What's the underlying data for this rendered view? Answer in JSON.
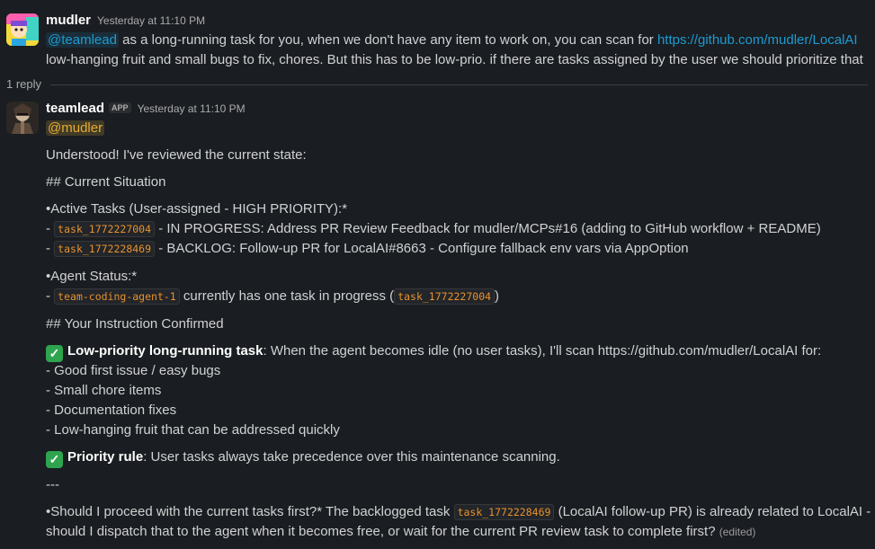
{
  "msg1": {
    "author": "mudler",
    "time": "Yesterday at 11:10 PM",
    "mention": "@teamlead",
    "text_a": " as a long-running task for you, when we don't have any item to work on, you can scan for ",
    "link": "https://github.com/mudler/LocalAI",
    "text_b": "low-hanging fruit and small bugs to fix, chores. But this has to be low-prio. if there are tasks assigned by the user we should prioritize that"
  },
  "replies": "1 reply",
  "msg2": {
    "author": "teamlead",
    "badge": "APP",
    "time": "Yesterday at 11:10 PM",
    "mention": "@mudler",
    "l1": "Understood! I've reviewed the current state:",
    "h1": "## Current Situation",
    "active": "•Active Tasks (User-assigned - HIGH PRIORITY):*",
    "dash": "- ",
    "task1_code": "task_1772227004",
    "task1_text": " - IN PROGRESS: Address PR Review Feedback for mudler/MCPs#16 (adding to GitHub workflow + README)",
    "task2_code": "task_1772228469",
    "task2_text": " - BACKLOG: Follow-up PR for LocalAI#8663 - Configure fallback env vars via AppOption",
    "agent": "•Agent Status:*",
    "agent_code": "team-coding-agent-1",
    "agent_text_a": " currently has one task in progress (",
    "agent_task_code": "task_1772227004",
    "agent_text_b": ")",
    "h2": "## Your Instruction Confirmed",
    "check_glyph": "✓",
    "lp_bold": "Low-priority long-running task",
    "lp_text": ": When the agent becomes idle (no user tasks), I'll scan https://github.com/mudler/LocalAI for:",
    "items": [
      "- Good first issue / easy bugs",
      "- Small chore items",
      "- Documentation fixes",
      "- Low-hanging fruit that can be addressed quickly"
    ],
    "pr_bold": "Priority rule",
    "pr_text": ": User tasks always take precedence over this maintenance scanning.",
    "sep": "---",
    "q_a": "•Should I proceed with the current tasks first?* The backlogged task ",
    "q_code": "task_1772228469",
    "q_b": " (LocalAI follow-up PR) is already related to LocalAI -",
    "q_c": "should I dispatch that to the agent when it becomes free, or wait for the current PR review task to complete first?",
    "edited": "(edited)"
  },
  "colors": {
    "background": "#1a1d21",
    "text": "#d1d2d3",
    "link": "#1d9bd1",
    "mention": "#e8ab31",
    "code": "#e8912d",
    "check": "#2ea44f"
  }
}
